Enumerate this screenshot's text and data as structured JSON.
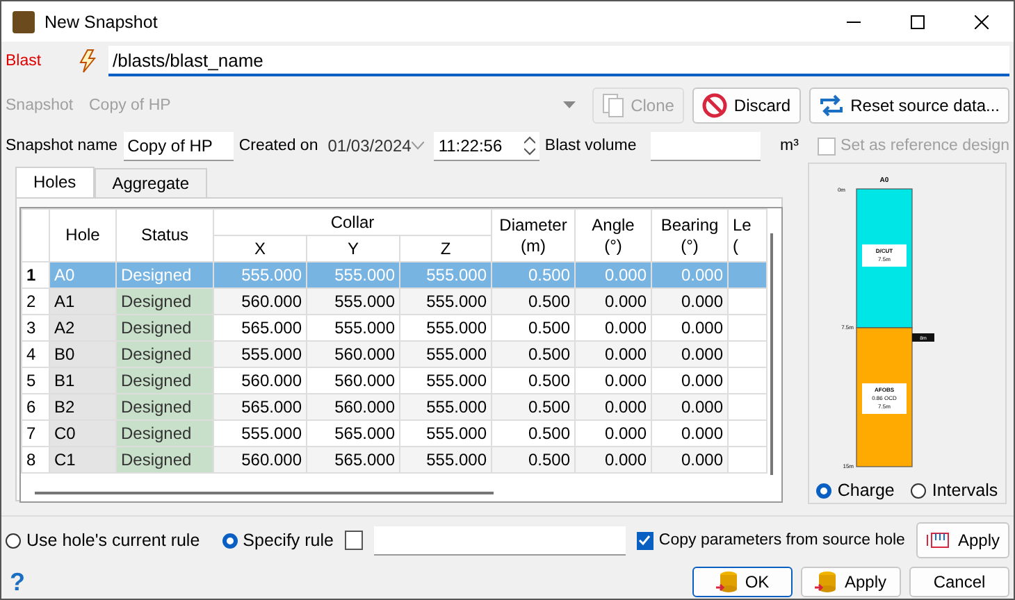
{
  "window": {
    "title": "New Snapshot"
  },
  "blast": {
    "label": "Blast",
    "value": "/blasts/blast_name"
  },
  "snapshot": {
    "label": "Snapshot",
    "value": "Copy of HP",
    "disabled": true,
    "buttons": [
      {
        "kind": "clone",
        "label": "Clone",
        "disabled": true
      },
      {
        "kind": "discard",
        "label": "Discard",
        "disabled": false
      },
      {
        "kind": "reset",
        "label": "Reset source data...",
        "disabled": false
      }
    ]
  },
  "details": {
    "name_label": "Snapshot name",
    "name": "Copy of HP",
    "created_label": "Created on",
    "date": "01/03/2024",
    "time": "11:22:56",
    "volume_label": "Blast volume",
    "volume_unit": "m³",
    "reference": {
      "label": "Set as reference design",
      "checked": false,
      "disabled": true
    }
  },
  "tabs": [
    {
      "label": "Holes",
      "selected": true
    },
    {
      "label": "Aggregate",
      "selected": false
    }
  ],
  "table": {
    "group": "Collar",
    "columns": [
      "Hole",
      "Status",
      "X",
      "Y",
      "Z",
      "Diameter\n(m)",
      "Angle\n(°)",
      "Bearing\n(°)",
      "Le\n("
    ],
    "rows": [
      {
        "index": "1",
        "cells": [
          "A0",
          "Designed",
          "555.000",
          "555.000",
          "555.000",
          "0.500",
          "0.000",
          "0.000"
        ],
        "selected": true
      },
      {
        "index": "2",
        "cells": [
          "A1",
          "Designed",
          "560.000",
          "555.000",
          "555.000",
          "0.500",
          "0.000",
          "0.000"
        ],
        "selected": false
      },
      {
        "index": "3",
        "cells": [
          "A2",
          "Designed",
          "565.000",
          "555.000",
          "555.000",
          "0.500",
          "0.000",
          "0.000"
        ],
        "selected": false
      },
      {
        "index": "4",
        "cells": [
          "B0",
          "Designed",
          "555.000",
          "560.000",
          "555.000",
          "0.500",
          "0.000",
          "0.000"
        ],
        "selected": false
      },
      {
        "index": "5",
        "cells": [
          "B1",
          "Designed",
          "560.000",
          "560.000",
          "555.000",
          "0.500",
          "0.000",
          "0.000"
        ],
        "selected": false
      },
      {
        "index": "6",
        "cells": [
          "B2",
          "Designed",
          "565.000",
          "560.000",
          "555.000",
          "0.500",
          "0.000",
          "0.000"
        ],
        "selected": false
      },
      {
        "index": "7",
        "cells": [
          "C0",
          "Designed",
          "555.000",
          "565.000",
          "555.000",
          "0.500",
          "0.000",
          "0.000"
        ],
        "selected": false
      },
      {
        "index": "8",
        "cells": [
          "C1",
          "Designed",
          "560.000",
          "565.000",
          "555.000",
          "0.500",
          "0.000",
          "0.000"
        ],
        "selected": false
      }
    ]
  },
  "charge": {
    "hole": "A0",
    "top_depth": "0m",
    "segments": [
      {
        "color": "#00e5e5",
        "lines": [
          "D/CUT",
          "7.5m"
        ],
        "depth": "7.5m"
      },
      {
        "color": "#ffaa00",
        "lines": [
          "AFOBS",
          "0.86 OCD",
          "7.5m"
        ],
        "depth": "15m"
      }
    ],
    "marker": "8m",
    "views": [
      {
        "label": "Charge",
        "selected": true
      },
      {
        "label": "Intervals",
        "selected": false
      }
    ]
  },
  "rule": {
    "options": [
      {
        "label": "Use hole's current rule",
        "selected": false
      },
      {
        "label": "Specify rule",
        "selected": true
      }
    ],
    "rule_checked": false,
    "copy": {
      "label": "Copy parameters from source hole",
      "checked": true
    },
    "apply": "Apply"
  },
  "footer": {
    "help": "?",
    "buttons": [
      {
        "kind": "ok",
        "label": "OK"
      },
      {
        "kind": "apply",
        "label": "Apply"
      },
      {
        "kind": "cancel",
        "label": "Cancel"
      }
    ]
  }
}
